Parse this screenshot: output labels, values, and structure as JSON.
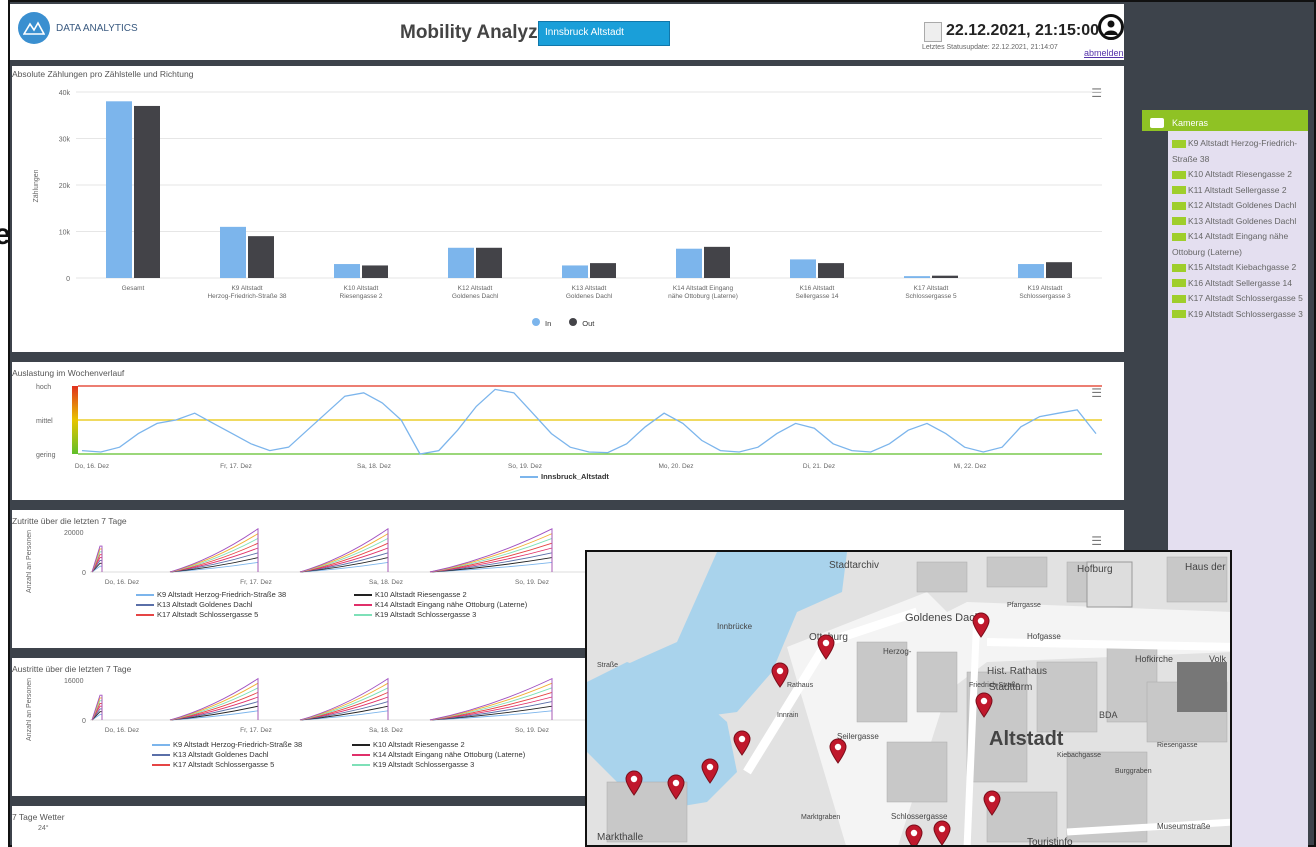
{
  "header": {
    "logo_text": "DATA ANALYTICS",
    "app_title": "Mobility Analyzer",
    "location": "Innsbruck Altstadt",
    "datetime": "22.12.2021, 21:15:00",
    "status": "Letztes Statusupdate: 22.12.2021, 21:14:07",
    "logout": "abmelden"
  },
  "left_edge_glyph": "e",
  "counts_panel": {
    "title": "Absolute Zählungen pro Zählstelle und Richtung",
    "legend_in": "In",
    "legend_out": "Out"
  },
  "week_panel": {
    "title": "Auslastung im Wochenverlauf",
    "series_name": "Innsbruck_Altstadt"
  },
  "entries_panel": {
    "title": "Zutritte über die letzten 7 Tage",
    "ylabel": "Anzahl an Personen",
    "ymax": "20000",
    "legend": [
      {
        "label": "K9 Altstadt Herzog-Friedrich-Straße 38",
        "color": "#7cb5ec"
      },
      {
        "label": "K10 Altstadt Riesengasse 2",
        "color": "#222222"
      },
      {
        "label": "K13 Altstadt Goldenes Dachl",
        "color": "#5a6fa8"
      },
      {
        "label": "K14 Altstadt Eingang nähe Ottoburg (Laterne)",
        "color": "#e0306a"
      },
      {
        "label": "K17 Altstadt Schlossergasse 5",
        "color": "#e54545"
      },
      {
        "label": "K19 Altstadt Schlossergasse 3",
        "color": "#7ee0b8"
      }
    ]
  },
  "exits_panel": {
    "title": "Austritte über die letzten 7 Tage",
    "ylabel": "Anzahl an Personen",
    "ymax": "16000",
    "legend": [
      {
        "label": "K9 Altstadt Herzog-Friedrich-Straße 38",
        "color": "#7cb5ec"
      },
      {
        "label": "K10 Altstadt Riesengasse 2",
        "color": "#222222"
      },
      {
        "label": "K13 Altstadt Goldenes Dachl",
        "color": "#5a6fa8"
      },
      {
        "label": "K14 Altstadt Eingang nähe Ottoburg (Laterne)",
        "color": "#e0306a"
      },
      {
        "label": "K17 Altstadt Schlossergasse 5",
        "color": "#e54545"
      },
      {
        "label": "K19 Altstadt Schlossergasse 3",
        "color": "#7ee0b8"
      }
    ]
  },
  "weather_panel": {
    "title": "7 Tage Wetter",
    "tick": "24°"
  },
  "sidebar": {
    "header": "Kameras",
    "cameras": [
      "K9 Altstadt Herzog-Friedrich-Straße 38",
      "K10 Altstadt Riesengasse 2",
      "K11 Altstadt Sellergasse 2",
      "K12 Altstadt Goldenes Dachl",
      "K13 Altstadt Goldenes Dachl",
      "K14 Altstadt Eingang nähe Ottoburg (Laterne)",
      "K15 Altstadt Kiebachgasse 2",
      "K16 Altstadt Sellergasse 14",
      "K17 Altstadt Schlossergasse 5",
      "K19 Altstadt Schlossergasse 3"
    ]
  },
  "map": {
    "labels": [
      "Stadtarchiv",
      "Hofburg",
      "Haus der",
      "Goldenes Dachl",
      "Ottoburg",
      "Herzog-",
      "Hofgasse",
      "Hofkirche",
      "Volk",
      "Hist. Rathaus",
      "Stadtturm",
      "Innbrücke",
      "Pfarrgasse",
      "Seilergasse",
      "BDA",
      "Altstadt",
      "Friedrich-Straße",
      "Kiebachgasse",
      "Burggraben",
      "Schlossergasse",
      "Markthalle",
      "Marktgraben",
      "Touristinfo",
      "Museumstraße",
      "Innrain",
      "Straße",
      "Rathaus",
      "Riesengasse"
    ]
  },
  "chart_data": [
    {
      "type": "bar",
      "title": "Absolute Zählungen pro Zählstelle und Richtung",
      "categories": [
        "Gesamt",
        "K9 Altstadt Herzog-Friedrich-Straße 38",
        "K10 Altstadt Riesengasse 2",
        "K12 Altstadt Goldenes Dachl",
        "K13 Altstadt Goldenes Dachl",
        "K14 Altstadt Eingang nähe Ottoburg (Laterne)",
        "K16 Altstadt Sellergasse 14",
        "K17 Altstadt Schlossergasse 5",
        "K19 Altstadt Schlossergasse 3"
      ],
      "series": [
        {
          "name": "In",
          "color": "#7cb5ec",
          "values": [
            38000,
            11000,
            3000,
            6500,
            2700,
            6300,
            4000,
            400,
            3000
          ]
        },
        {
          "name": "Out",
          "color": "#434348",
          "values": [
            37000,
            9000,
            2700,
            6500,
            3200,
            6700,
            3200,
            500,
            3400
          ]
        }
      ],
      "ylabel": "Zählungen",
      "ylim": [
        0,
        40000
      ],
      "yticks": [
        "0",
        "10k",
        "20k",
        "30k",
        "40k"
      ],
      "legend": "bottom-center"
    },
    {
      "type": "line",
      "title": "Auslastung im Wochenverlauf",
      "x_ticks": [
        "Do, 16. Dez",
        "Fr, 17. Dez",
        "Sa, 18. Dez",
        "So, 19. Dez",
        "Mo, 20. Dez",
        "Di, 21. Dez",
        "Mi, 22. Dez"
      ],
      "y_ticks": [
        "gering",
        "mittel",
        "hoch"
      ],
      "series": [
        {
          "name": "Innsbruck_Altstadt",
          "color": "#7cb5ec",
          "values": [
            0.05,
            0.03,
            0.1,
            0.3,
            0.45,
            0.5,
            0.6,
            0.45,
            0.3,
            0.15,
            0.05,
            0.1,
            0.35,
            0.6,
            0.85,
            0.9,
            0.75,
            0.5,
            0.0,
            0.05,
            0.35,
            0.7,
            0.95,
            0.9,
            0.6,
            0.3,
            0.1,
            0.03,
            0.02,
            0.15,
            0.4,
            0.6,
            0.45,
            0.2,
            0.05,
            0.03,
            0.1,
            0.3,
            0.45,
            0.38,
            0.15,
            0.05,
            0.03,
            0.15,
            0.35,
            0.45,
            0.3,
            0.1,
            0.03,
            0.1,
            0.4,
            0.55,
            0.6,
            0.65,
            0.3
          ]
        }
      ]
    },
    {
      "type": "line",
      "title": "Zutritte über die letzten 7 Tage",
      "x_ticks": [
        "Do, 16. Dez",
        "Fr, 17. Dez",
        "Sa, 18. Dez",
        "So, 19. Dez"
      ],
      "ylabel": "Anzahl an Personen",
      "y_ticks": [
        "0",
        "20000"
      ]
    },
    {
      "type": "line",
      "title": "Austritte über die letzten 7 Tage",
      "x_ticks": [
        "Do, 16. Dez",
        "Fr, 17. Dez",
        "Sa, 18. Dez",
        "So, 19. Dez"
      ],
      "ylabel": "Anzahl an Personen",
      "y_ticks": [
        "0",
        "16000"
      ]
    }
  ]
}
